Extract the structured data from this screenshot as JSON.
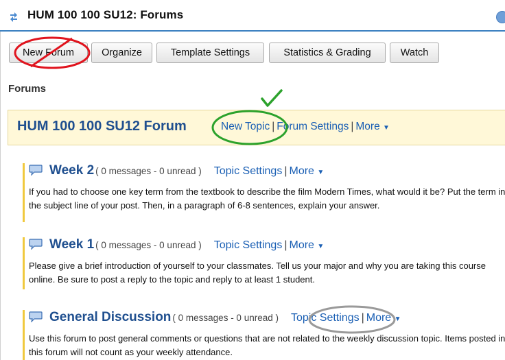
{
  "header": {
    "title": "HUM 100 100 SU12: Forums"
  },
  "toolbar": {
    "buttons": [
      {
        "label": "New Forum"
      },
      {
        "label": "Organize"
      },
      {
        "label": "Template Settings"
      },
      {
        "label": "Statistics & Grading"
      },
      {
        "label": "Watch"
      }
    ]
  },
  "page": {
    "section_title": "Forums"
  },
  "forum": {
    "name": "HUM 100 100 SU12 Forum",
    "new_topic": "New Topic",
    "settings": "Forum Settings",
    "more": "More"
  },
  "topics": [
    {
      "name": "Week 2",
      "counts": "( 0 messages - 0 unread )",
      "settings": "Topic Settings",
      "more": "More",
      "description": "If you had to choose one key term from the textbook to describe the film Modern Times, what would it be? Put the term in the subject line of your post. Then, in a paragraph of 6-8 sentences, explain your answer."
    },
    {
      "name": "Week 1",
      "counts": "( 0 messages - 0 unread )",
      "settings": "Topic Settings",
      "more": "More",
      "description": "Please give a brief introduction of yourself to your classmates. Tell us your major and why you are taking this course online. Be sure to post a reply to the topic and reply to at least 1 student."
    },
    {
      "name": "General Discussion",
      "counts": "( 0 messages - 0 unread )",
      "settings": "Topic Settings",
      "more": "More",
      "description": "Use this forum to post general comments or questions that are not related to the weekly discussion topic. Items posted in this forum will not count as your weekly attendance."
    }
  ],
  "annotations": {
    "cross_color": "#e0141e",
    "check_color": "#2ca22c",
    "circle_gray": "#9a9a9a"
  },
  "icons": {
    "title": "arrows-icon",
    "help": "help-icon",
    "topic": "speech-bubble-icon",
    "caret": "caret-down-icon"
  }
}
